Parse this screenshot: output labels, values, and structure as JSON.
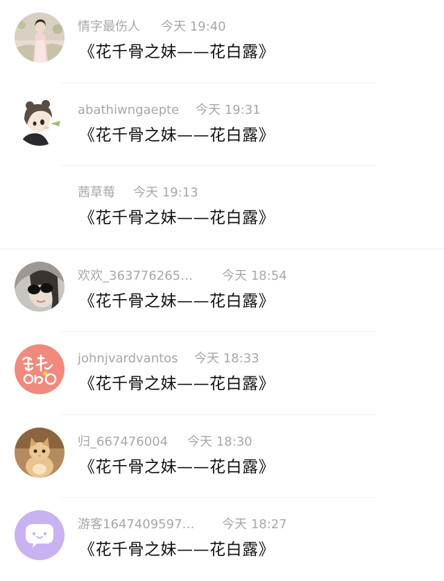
{
  "comments": [
    {
      "username": "情字最伤人",
      "time": "今天 19:40",
      "text": "《花千骨之妹——花白露》",
      "avatar": "girl-hanfu-avatar"
    },
    {
      "username": "abathiwngaepte",
      "time": "今天 19:31",
      "text": "《花千骨之妹——花白露》",
      "avatar": "cartoon-girl-avatar"
    },
    {
      "username": "茜草莓",
      "time": "今天 19:13",
      "text": "《花千骨之妹——花白露》",
      "avatar": ""
    },
    {
      "username": "欢欢_363776265…",
      "time": "今天 18:54",
      "text": "《花千骨之妹——花白露》",
      "avatar": "sunglasses-woman-avatar"
    },
    {
      "username": "johnjvardvantos",
      "time": "今天 18:33",
      "text": "《花千骨之妹——花白露》",
      "avatar": "coral-calligraphy-avatar"
    },
    {
      "username": "归_667476004",
      "time": "今天 18:30",
      "text": "《花千骨之妹——花白露》",
      "avatar": "cat-avatar"
    },
    {
      "username": "游客1647409597…",
      "time": "今天 18:27",
      "text": "《花千骨之妹——花白露》",
      "avatar": "purple-chat-bubble-avatar"
    }
  ]
}
